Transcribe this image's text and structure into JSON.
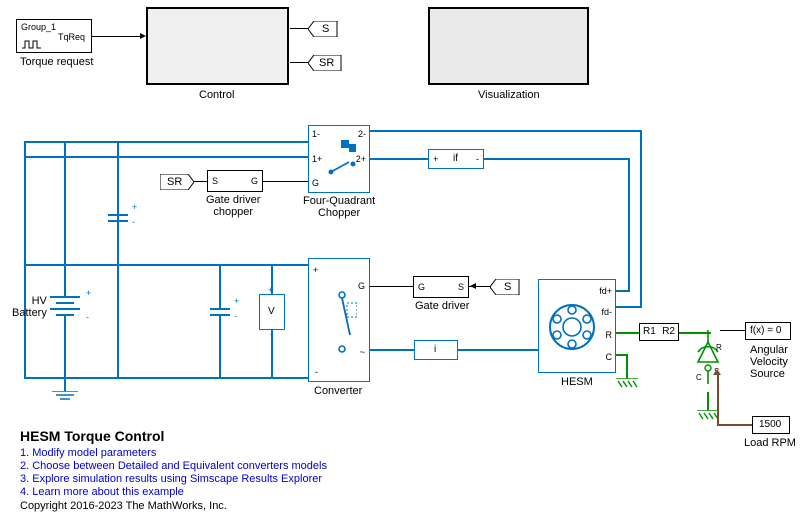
{
  "blocks": {
    "torque_request": {
      "group": "Group_1",
      "signal": "TqReq",
      "label": "Torque request"
    },
    "control": {
      "label": "Control"
    },
    "visualization": {
      "label": "Visualization"
    },
    "gate_driver_chopper": {
      "s": "S",
      "g": "G",
      "label": "Gate driver\nchopper"
    },
    "four_quadrant_chopper": {
      "p1m": "1-",
      "p1p": "1+",
      "pg": "G",
      "p2m": "2-",
      "p2p": "2+",
      "label": "Four-Quadrant\nChopper"
    },
    "converter": {
      "label": "Converter",
      "ports": {
        "p": "+",
        "m": "-",
        "g": "G",
        "ac": "~"
      }
    },
    "gate_driver": {
      "g": "G",
      "s": "S",
      "label": "Gate driver"
    },
    "hesm": {
      "label": "HESM",
      "ports": {
        "fdp": "fd+",
        "fdm": "fd-",
        "r": "R",
        "c": "C"
      }
    },
    "hv_battery": {
      "label": "HV\nBattery"
    },
    "voltage_sensor": {
      "p": "+",
      "m": "-",
      "mid": "V"
    },
    "current_if": {
      "p": "+",
      "m": "-",
      "mid": "if"
    },
    "current_i": {
      "mid": "i"
    },
    "r1": "R1",
    "r2": "R2",
    "angular_velocity": {
      "expr": "f(x) = 0",
      "label": "Angular\nVelocity\nSource"
    },
    "load_rpm": {
      "val": "1500",
      "label": "Load RPM"
    }
  },
  "tags": {
    "s": "S",
    "sr": "SR"
  },
  "text": {
    "title": "HESM Torque Control",
    "step1": "1. Modify model parameters",
    "step2": "2. Choose between Detailed and Equivalent converters models",
    "step3": "3. Explore simulation results using Simscape Results Explorer",
    "step4": "4. Learn more about this example",
    "copyright": "Copyright 2016-2023 The MathWorks, Inc."
  }
}
